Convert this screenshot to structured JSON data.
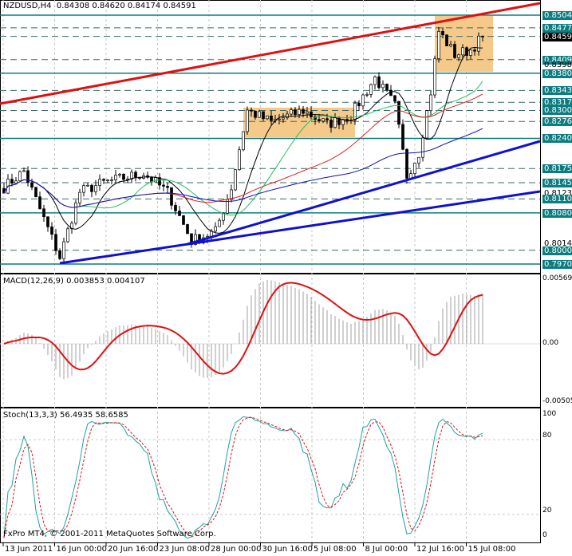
{
  "header": {
    "symbol": "NZDUSD,H4",
    "open": "0.84308",
    "high": "0.84620",
    "low": "0.84174",
    "close": "0.84591"
  },
  "macd": {
    "label": "MACD(12,26,9) 0.003853 0.004107",
    "scale": [
      "0.00569",
      "0.00",
      "-0.00505"
    ]
  },
  "stoch": {
    "label": "Stoch(13,3,3) 56.4935 58.6585",
    "scale": [
      "100",
      "80",
      "20",
      "0"
    ]
  },
  "copyright": "FxPro MT4, © 2001-2011 MetaQuotes Software Corp.",
  "time_labels": [
    "13 Jun 2011",
    "16 Jun 00:00",
    "20 Jun 16:00",
    "23 Jun 08:00",
    "28 Jun 00:00",
    "30 Jun 16:00",
    "5 Jul 08:00",
    "8 Jul 00:00",
    "12 Jul 16:00",
    "15 Jul 08:00"
  ],
  "price_labels": [
    {
      "v": "0.85046",
      "t": "teal"
    },
    {
      "v": "0.84774",
      "t": "teal"
    },
    {
      "v": "0.84591",
      "t": "cur"
    },
    {
      "v": "0.84091",
      "t": "teal"
    },
    {
      "v": "0.83980",
      "t": "plain"
    },
    {
      "v": "0.83800",
      "t": "teal"
    },
    {
      "v": "0.83430",
      "t": "teal"
    },
    {
      "v": "0.83175",
      "t": "teal"
    },
    {
      "v": "0.83000",
      "t": "teal"
    },
    {
      "v": "0.82765",
      "t": "teal"
    },
    {
      "v": "0.82400",
      "t": "teal"
    },
    {
      "v": "0.81754",
      "t": "teal"
    },
    {
      "v": "0.81450",
      "t": "teal"
    },
    {
      "v": "0.81235",
      "t": "plain"
    },
    {
      "v": "0.81100",
      "t": "teal"
    },
    {
      "v": "0.80800",
      "t": "teal"
    },
    {
      "v": "0.80140",
      "t": "plain"
    },
    {
      "v": "0.80000",
      "t": "teal"
    },
    {
      "v": "0.79703",
      "t": "teal"
    }
  ],
  "colors": {
    "teal": "#0b7c80",
    "trend_red": "#e01010",
    "trend_blue": "#1010d0",
    "zone": "#f5c98a"
  },
  "chart_data": {
    "type": "candlestick",
    "symbol": "NZDUSD",
    "timeframe": "H4",
    "approx_path": [
      [
        0,
        0.8135
      ],
      [
        5,
        0.817
      ],
      [
        14,
        0.7985
      ],
      [
        19,
        0.8125
      ],
      [
        25,
        0.8145
      ],
      [
        35,
        0.8165
      ],
      [
        41,
        0.8125
      ],
      [
        47,
        0.802
      ],
      [
        53,
        0.804
      ],
      [
        57,
        0.8135
      ],
      [
        61,
        0.83
      ],
      [
        67,
        0.8275
      ],
      [
        75,
        0.83
      ],
      [
        81,
        0.827
      ],
      [
        87,
        0.829
      ],
      [
        93,
        0.837
      ],
      [
        98,
        0.831
      ],
      [
        101,
        0.816
      ],
      [
        104,
        0.821
      ],
      [
        107,
        0.834
      ],
      [
        109,
        0.847
      ],
      [
        113,
        0.842
      ],
      [
        117,
        0.843
      ],
      [
        120,
        0.8459
      ]
    ]
  }
}
